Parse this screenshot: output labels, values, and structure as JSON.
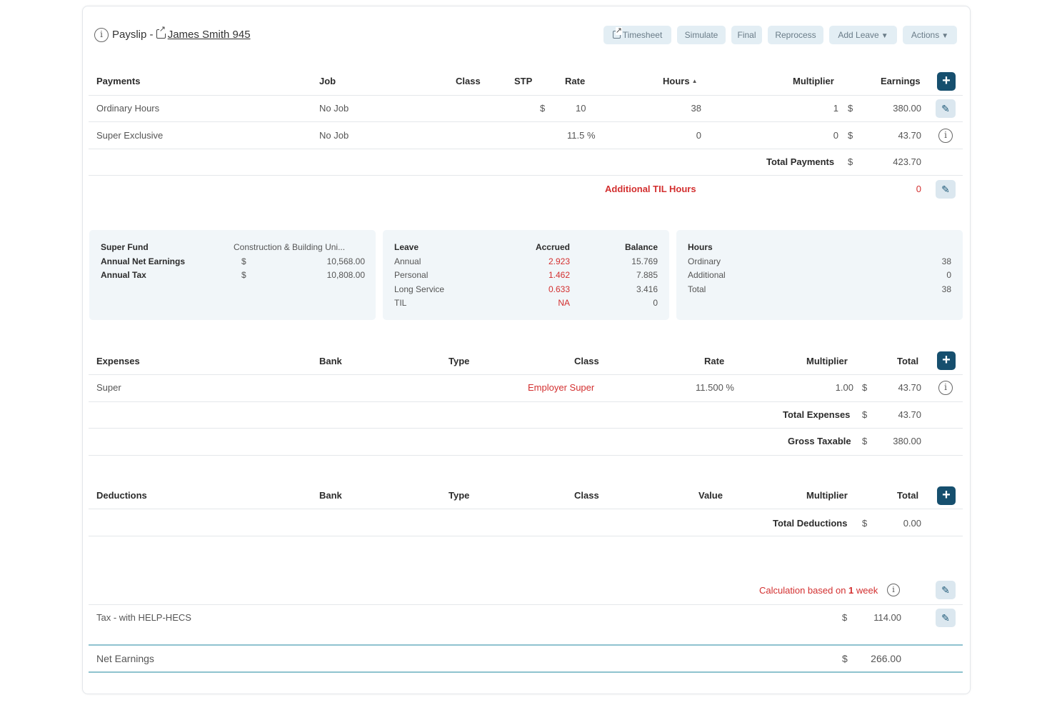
{
  "header": {
    "title_prefix": "Payslip - ",
    "employee_link": "James Smith 945",
    "buttons": {
      "timesheet": "Timesheet",
      "simulate": "Simulate",
      "final": "Final",
      "reprocess": "Reprocess",
      "add_leave": "Add Leave",
      "actions": "Actions"
    }
  },
  "payments": {
    "headers": [
      "Payments",
      "Job",
      "Class",
      "STP",
      "Rate",
      "Hours",
      "Multiplier",
      "Earnings"
    ],
    "rows": [
      {
        "name": "Ordinary Hours",
        "job": "No Job",
        "rate_currency": "$",
        "rate": "10",
        "hours": "38",
        "multiplier": "1",
        "currency": "$",
        "earnings": "380.00"
      },
      {
        "name": "Super Exclusive",
        "job": "No Job",
        "rate_currency": "",
        "rate": "11.5 %",
        "hours": "0",
        "multiplier": "0",
        "currency": "$",
        "earnings": "43.70"
      }
    ],
    "total_label": "Total Payments",
    "total_currency": "$",
    "total_value": "423.70",
    "til_label": "Additional TIL Hours",
    "til_value": "0"
  },
  "super_panel": {
    "fund_label": "Super Fund",
    "fund_value": "Construction & Building Uni...",
    "net_label": "Annual Net Earnings",
    "net_currency": "$",
    "net_value": "10,568.00",
    "tax_label": "Annual Tax",
    "tax_currency": "$",
    "tax_value": "10,808.00"
  },
  "leave_panel": {
    "headers": [
      "Leave",
      "Accrued",
      "Balance"
    ],
    "rows": [
      {
        "name": "Annual",
        "accrued": "2.923",
        "balance": "15.769"
      },
      {
        "name": "Personal",
        "accrued": "1.462",
        "balance": "7.885"
      },
      {
        "name": "Long Service",
        "accrued": "0.633",
        "balance": "3.416"
      },
      {
        "name": "TIL",
        "accrued": "NA",
        "balance": "0"
      }
    ]
  },
  "hours_panel": {
    "header": "Hours",
    "rows": [
      {
        "name": "Ordinary",
        "value": "38"
      },
      {
        "name": "Additional",
        "value": "0"
      },
      {
        "name": "Total",
        "value": "38"
      }
    ]
  },
  "expenses": {
    "headers": [
      "Expenses",
      "Bank",
      "Type",
      "Class",
      "Rate",
      "Multiplier",
      "Total"
    ],
    "rows": [
      {
        "name": "Super",
        "class": "Employer Super",
        "rate": "11.500 %",
        "multiplier": "1.00",
        "currency": "$",
        "total": "43.70"
      }
    ],
    "total_label": "Total Expenses",
    "total_currency": "$",
    "total_value": "43.70",
    "gross_label": "Gross Taxable",
    "gross_currency": "$",
    "gross_value": "380.00"
  },
  "deductions": {
    "headers": [
      "Deductions",
      "Bank",
      "Type",
      "Class",
      "Value",
      "Multiplier",
      "Total"
    ],
    "total_label": "Total Deductions",
    "total_currency": "$",
    "total_value": "0.00"
  },
  "tax": {
    "calc_prefix": "Calculation based on ",
    "calc_count": "1",
    "calc_suffix": " week",
    "label": "Tax - with HELP-HECS",
    "currency": "$",
    "value": "114.00"
  },
  "net": {
    "label": "Net Earnings",
    "currency": "$",
    "value": "266.00"
  },
  "colors": {
    "accent": "#164f6e",
    "button_bg": "#e3eef4",
    "panel_bg": "#f1f6f9",
    "red": "#d32f2f",
    "teal_line": "#8fc3cf"
  }
}
